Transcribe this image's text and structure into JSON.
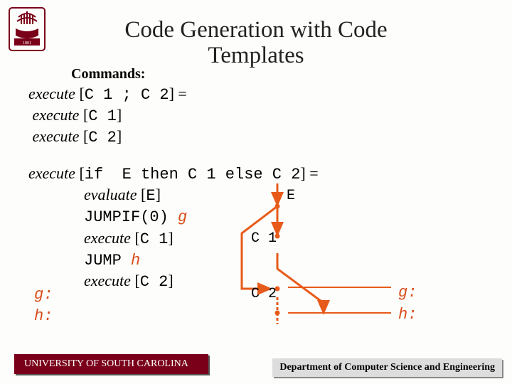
{
  "title_line1": "Code Generation with Code",
  "title_line2": "Templates",
  "subhead": "Commands:",
  "seq": {
    "l1a": "execute ",
    "l1b": "[",
    "l1c": "C 1 ; C 2",
    "l1d": "] =",
    "l2a": " execute ",
    "l2b": "[",
    "l2c": "C 1",
    "l2d": "]",
    "l3a": " execute ",
    "l3b": "[",
    "l3c": "C 2",
    "l3d": "]"
  },
  "ifblk": {
    "l1a": "execute ",
    "l1b": "[",
    "l1c": "if  E then C 1 else C 2",
    "l1d": "] =",
    "l2a": "evaluate ",
    "l2b": "[",
    "l2c": "E",
    "l2d": "]",
    "l3a": "JUMPIF(0) ",
    "l3b": "g",
    "l4a": "execute ",
    "l4b": "[",
    "l4c": "C 1",
    "l4d": "]",
    "l5a": "JUMP ",
    "l5b": "h",
    "l6a": "execute ",
    "l6b": "[",
    "l6c": "C 2",
    "l6d": "]"
  },
  "labels_left": {
    "g": "g:",
    "h": "h:"
  },
  "labels_right": {
    "g": "g:",
    "h": "h:"
  },
  "diagram": {
    "E": "E",
    "C1": "C 1",
    "C2": "C 2"
  },
  "footer": {
    "left": "UNIVERSITY OF SOUTH CAROLINA",
    "right": "Department of Computer Science and Engineering"
  }
}
